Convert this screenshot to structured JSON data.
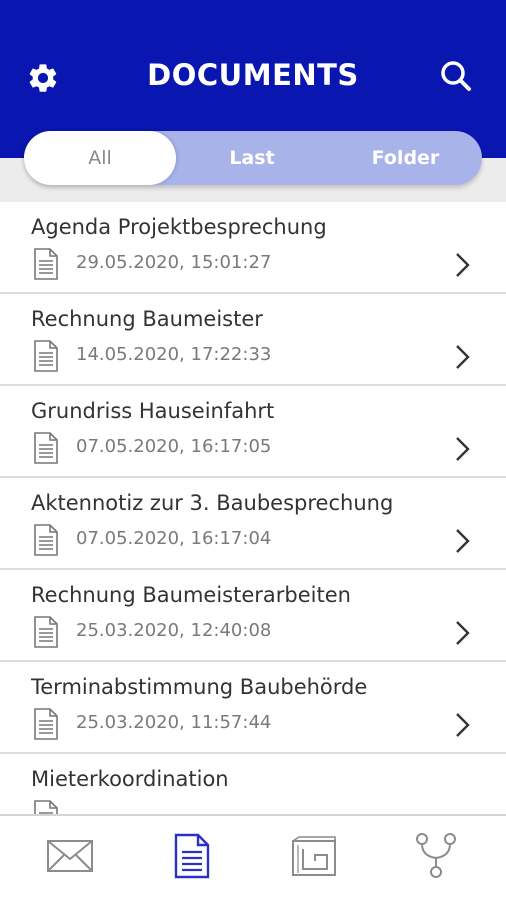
{
  "header": {
    "title": "DOCUMENTS",
    "settings_icon": "gear-icon",
    "search_icon": "search-icon",
    "background_color": "#0a16b0"
  },
  "filter_tabs": [
    {
      "label": "All",
      "active": true
    },
    {
      "label": "Last",
      "active": false
    },
    {
      "label": "Folder",
      "active": false
    }
  ],
  "documents": [
    {
      "title": "Agenda Projektbesprechung",
      "date": "29.05.2020, 15:01:27"
    },
    {
      "title": "Rechnung Baumeister",
      "date": "14.05.2020, 17:22:33"
    },
    {
      "title": "Grundriss Hauseinfahrt",
      "date": "07.05.2020, 16:17:05"
    },
    {
      "title": "Aktennotiz zur 3. Baubesprechung",
      "date": "07.05.2020, 16:17:04"
    },
    {
      "title": "Rechnung Baumeisterarbeiten",
      "date": "25.03.2020, 12:40:08"
    },
    {
      "title": "Terminabstimmung Baubehörde",
      "date": "25.03.2020, 11:57:44"
    },
    {
      "title": "Mieterkoordination",
      "date": ""
    }
  ],
  "bottom_nav": [
    {
      "icon": "mail-icon",
      "active": false
    },
    {
      "icon": "document-icon",
      "active": true
    },
    {
      "icon": "floorplan-icon",
      "active": false
    },
    {
      "icon": "workflow-icon",
      "active": false
    }
  ],
  "colors": {
    "accent": "#0a16b0",
    "segment_bg": "#a8b3ea",
    "active_nav": "#2a30c8",
    "inactive_nav": "#8c8c8c"
  }
}
